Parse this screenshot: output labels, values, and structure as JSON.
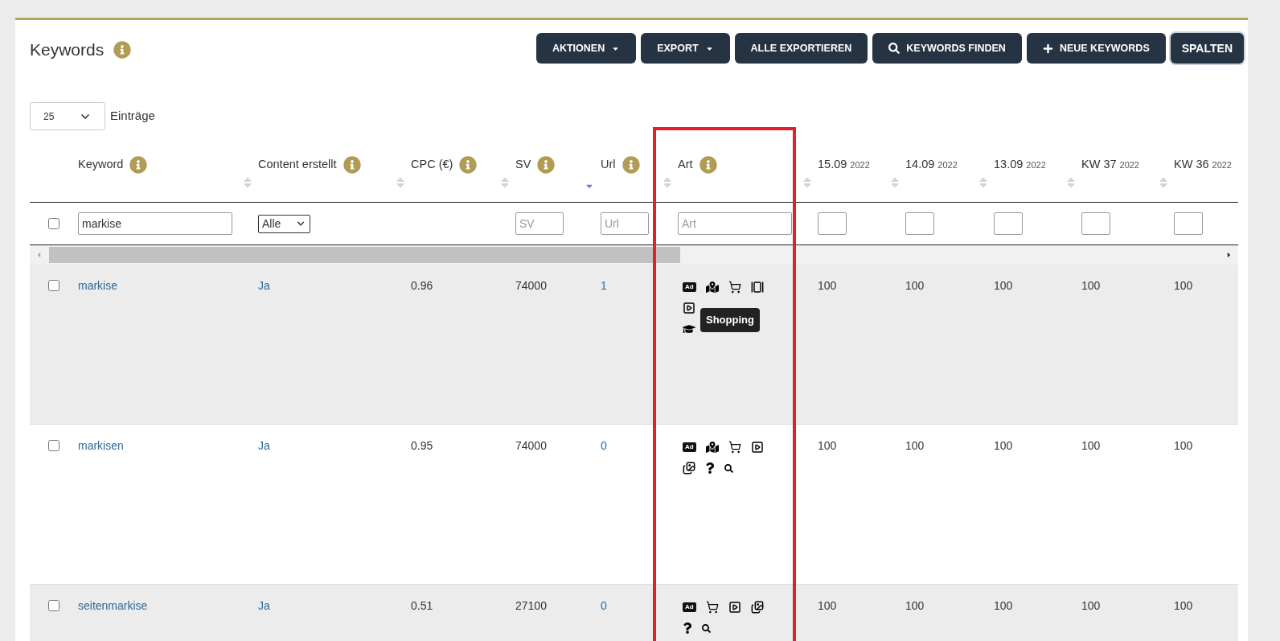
{
  "page": {
    "title": "Keywords"
  },
  "toolbar": [
    {
      "label": "AKTIONEN",
      "kind": "dropdown"
    },
    {
      "label": "EXPORT",
      "kind": "dropdown"
    },
    {
      "label": "ALLE EXPORTIEREN",
      "kind": "plain"
    },
    {
      "label": "KEYWORDS FINDEN",
      "kind": "search"
    },
    {
      "label": "NEUE KEYWORDS",
      "kind": "add"
    },
    {
      "label": "SPALTEN",
      "kind": "large"
    }
  ],
  "page_size": {
    "value": "25",
    "label": "Einträge"
  },
  "columns": [
    {
      "label": "Keyword",
      "info": true,
      "sorted": false
    },
    {
      "label": "Content erstellt",
      "info": true,
      "sorted": false
    },
    {
      "label": "CPC (€)",
      "info": true,
      "sorted": false
    },
    {
      "label": "SV",
      "info": true,
      "sorted": true
    },
    {
      "label": "Url",
      "info": true,
      "sorted": false
    },
    {
      "label": "Art",
      "info": true,
      "sorted": false
    },
    {
      "label": "15.09",
      "year": "2022",
      "info": false,
      "sorted": false
    },
    {
      "label": "14.09",
      "year": "2022",
      "info": false,
      "sorted": false
    },
    {
      "label": "13.09",
      "year": "2022",
      "info": false,
      "sorted": false
    },
    {
      "label": "KW 37",
      "year": "2022",
      "info": false,
      "sorted": false
    },
    {
      "label": "KW 36",
      "year": "2022",
      "info": false
    }
  ],
  "filters": {
    "select_all_checked": false,
    "cells": [
      {
        "kind": "text",
        "value": "markise"
      },
      {
        "kind": "select",
        "value": "Alle"
      },
      {
        "kind": "none"
      },
      {
        "kind": "text",
        "placeholder": "SV"
      },
      {
        "kind": "text",
        "placeholder": "Url"
      },
      {
        "kind": "text",
        "placeholder": "Art"
      },
      {
        "kind": "box"
      },
      {
        "kind": "box"
      },
      {
        "kind": "box"
      },
      {
        "kind": "box"
      },
      {
        "kind": "box"
      }
    ]
  },
  "rows": [
    {
      "checked": false,
      "keyword": "markise",
      "content": "Ja",
      "cpc": "0.96",
      "sv": "74000",
      "url": "1",
      "art": [
        [
          {
            "kind": "ad",
            "label": "Ad"
          },
          {
            "kind": "map"
          },
          {
            "kind": "cart"
          },
          {
            "kind": "carousel"
          }
        ],
        [
          {
            "kind": "video"
          }
        ],
        [
          {
            "kind": "graduation"
          }
        ]
      ],
      "tooltip": "Shopping",
      "values": [
        "100",
        "100",
        "100",
        "100",
        "100"
      ]
    },
    {
      "checked": false,
      "keyword": "markisen",
      "content": "Ja",
      "cpc": "0.95",
      "sv": "74000",
      "url": "0",
      "art": [
        [
          {
            "kind": "ad",
            "label": "Ad"
          },
          {
            "kind": "map"
          },
          {
            "kind": "cart"
          },
          {
            "kind": "video"
          }
        ],
        [
          {
            "kind": "images"
          },
          {
            "kind": "question"
          },
          {
            "kind": "search"
          }
        ]
      ],
      "values": [
        "100",
        "100",
        "100",
        "100",
        "100"
      ]
    },
    {
      "checked": false,
      "keyword": "seitenmarkise",
      "content": "Ja",
      "cpc": "0.51",
      "sv": "27100",
      "url": "0",
      "art": [
        [
          {
            "kind": "ad",
            "label": "Ad"
          },
          {
            "kind": "cart"
          },
          {
            "kind": "video"
          },
          {
            "kind": "images"
          }
        ],
        [
          {
            "kind": "question"
          },
          {
            "kind": "search"
          }
        ]
      ],
      "values": [
        "100",
        "100",
        "100",
        "100",
        "100"
      ]
    }
  ]
}
